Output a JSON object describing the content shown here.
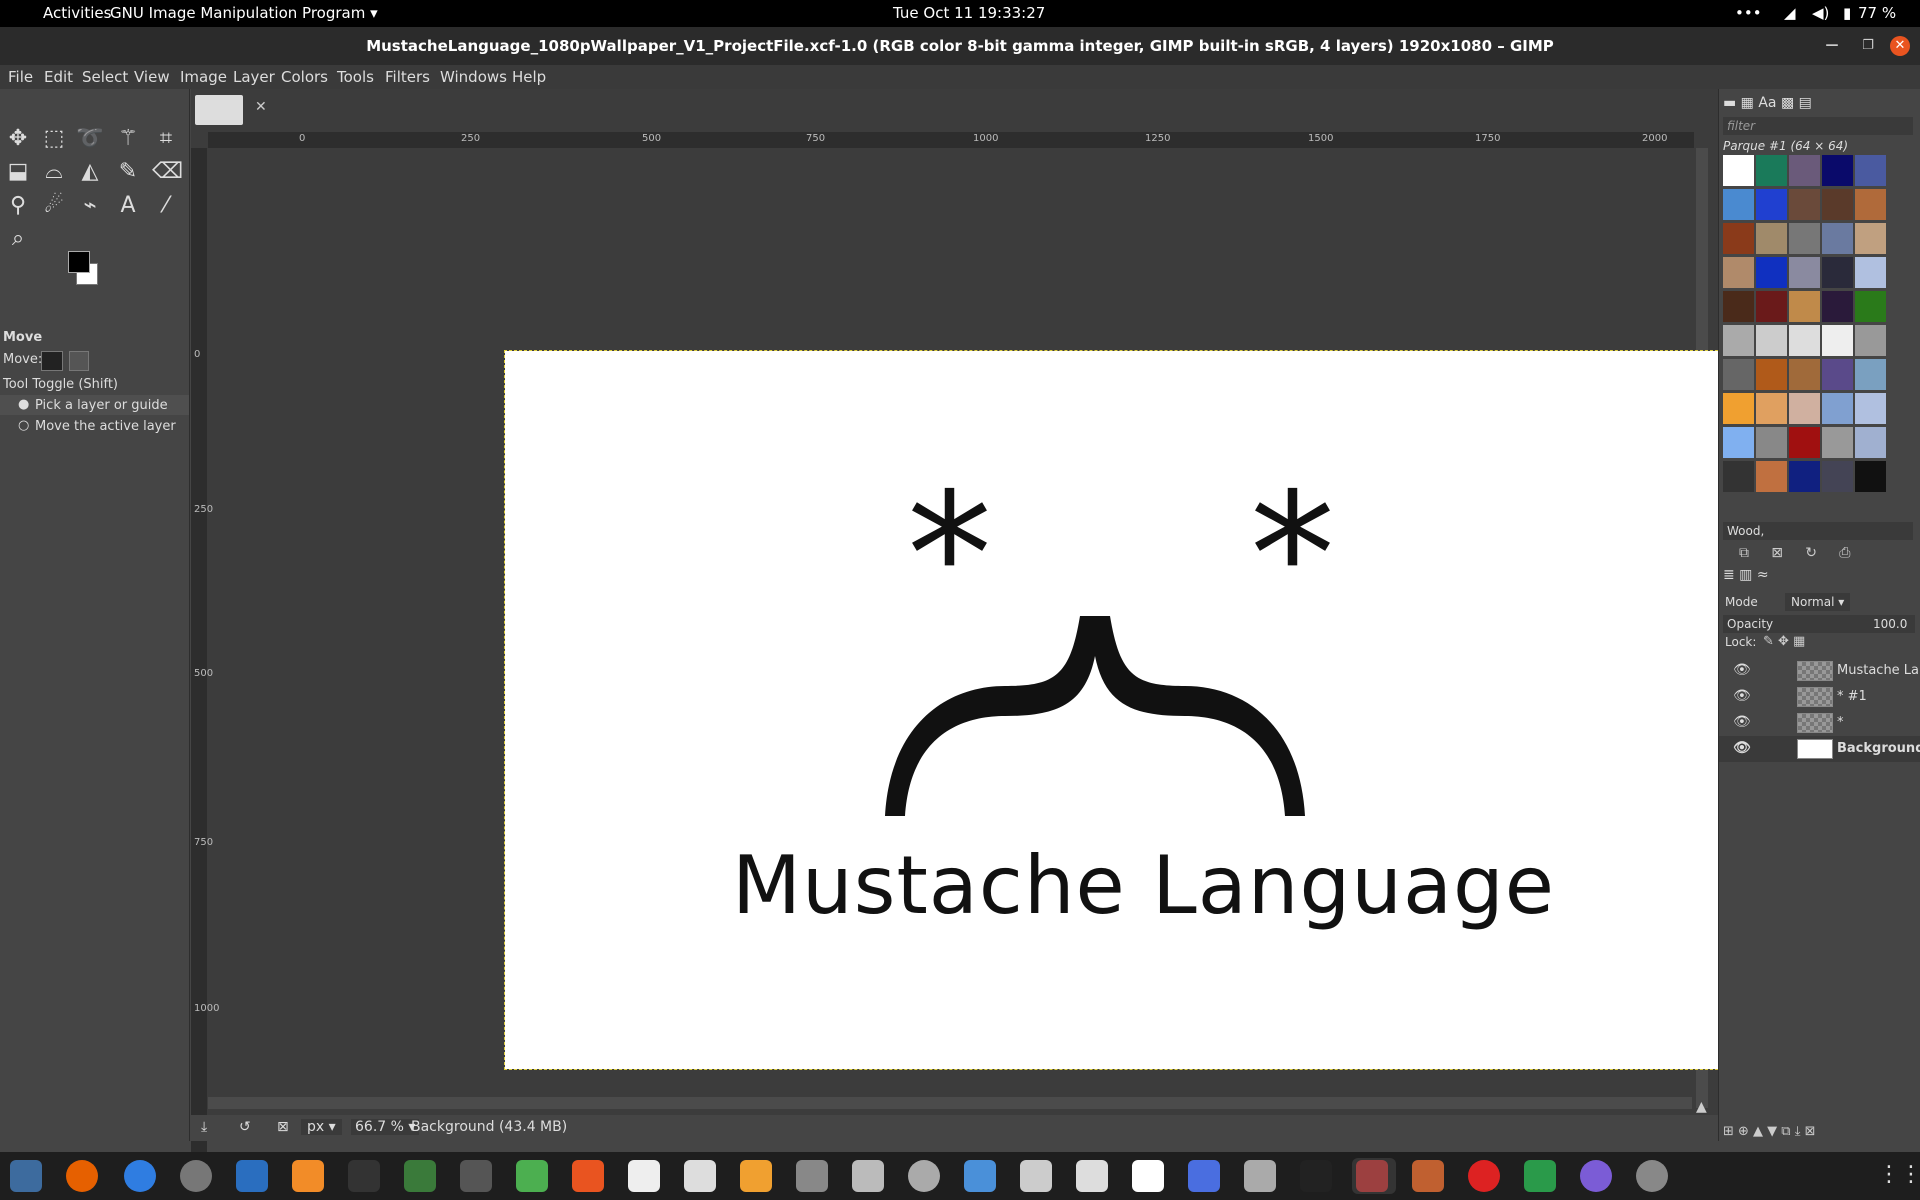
{
  "system_bar": {
    "activities": "Activities",
    "app_menu": "GNU Image Manipulation Program",
    "datetime": "Tue Oct 11  19:33:27",
    "battery": "77 %"
  },
  "window": {
    "title": "MustacheLanguage_1080pWallpaper_V1_ProjectFile.xcf-1.0 (RGB color 8-bit gamma integer, GIMP built-in sRGB, 4 layers) 1920x1080 – GIMP"
  },
  "menu": [
    "File",
    "Edit",
    "Select",
    "View",
    "Image",
    "Layer",
    "Colors",
    "Tools",
    "Filters",
    "Windows",
    "Help"
  ],
  "tool_options": {
    "title": "Move",
    "move_label": "Move:",
    "toggle": "Tool Toggle  (Shift)",
    "option1": "Pick a layer or guide",
    "option2": "Move the active layer"
  },
  "ruler_ticks": [
    "0",
    "250",
    "500",
    "750",
    "1000",
    "1250",
    "1500",
    "1750",
    "2000"
  ],
  "vruler_ticks": [
    "0",
    "250",
    "500",
    "750",
    "1000"
  ],
  "canvas": {
    "asterisk": "*",
    "logo_text": "Mustache Language"
  },
  "patterns": {
    "filter_placeholder": "filter",
    "current": "Parque #1 (64 × 64)",
    "selected_name": "Wood,"
  },
  "layers": {
    "mode_label": "Mode",
    "mode_value": "Normal",
    "opacity_label": "Opacity",
    "opacity_value": "100.0",
    "lock_label": "Lock:",
    "items": [
      {
        "name": "Mustache Language"
      },
      {
        "name": "* #1"
      },
      {
        "name": "*"
      },
      {
        "name": "Background"
      }
    ]
  },
  "status": {
    "unit": "px",
    "zoom": "66.7 %",
    "info": "Background (43.4 MB)"
  },
  "colors": {
    "accent": "#e95420",
    "fg": "#000000",
    "bg": "#ffffff"
  }
}
